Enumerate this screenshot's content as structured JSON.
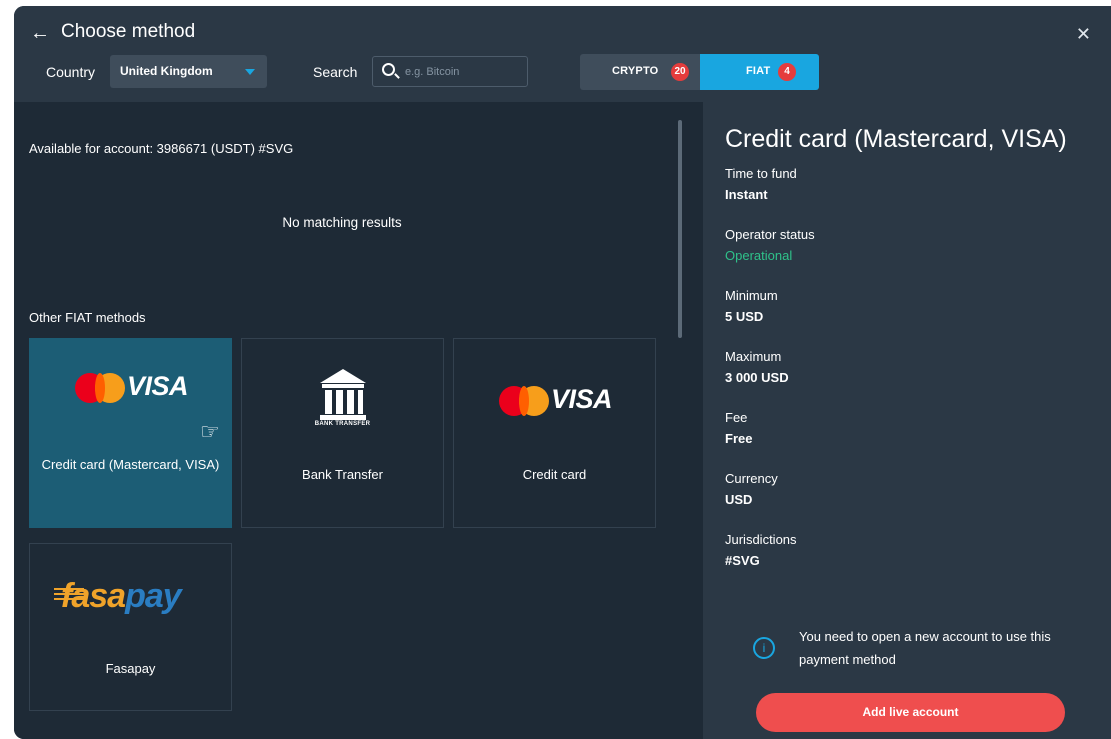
{
  "header": {
    "title": "Choose method",
    "country_label": "Country",
    "country_value": "United Kingdom",
    "search_label": "Search",
    "search_placeholder": "e.g. Bitcoin",
    "tabs": [
      {
        "label": "CRYPTO",
        "count": "20",
        "active": false
      },
      {
        "label": "FIAT",
        "count": "4",
        "active": true
      }
    ]
  },
  "left": {
    "available_text": "Available for account: 3986671 (USDT) #SVG",
    "no_results": "No matching results",
    "other_title": "Other FIAT methods",
    "methods": [
      {
        "label": "Credit card (Mastercard, VISA)",
        "logo": "mastercard-visa",
        "selected": true
      },
      {
        "label": "Bank Transfer",
        "logo": "bank-transfer",
        "logo_caption": "BANK TRANSFER",
        "selected": false
      },
      {
        "label": "Credit card",
        "logo": "mastercard-visa",
        "selected": false
      },
      {
        "label": "Fasapay",
        "logo": "fasapay",
        "selected": false
      }
    ],
    "visa_text": "VISA",
    "fasapay_logo": {
      "part1": "fasa",
      "part2": "pay"
    }
  },
  "detail": {
    "title": "Credit card (Mastercard, VISA)",
    "fields": [
      {
        "key": "Time to fund",
        "value": "Instant"
      },
      {
        "key": "Operator status",
        "value": "Operational"
      },
      {
        "key": "Minimum",
        "value": "5 USD"
      },
      {
        "key": "Maximum",
        "value": "3 000 USD"
      },
      {
        "key": "Fee",
        "value": "Free"
      },
      {
        "key": "Currency",
        "value": "USD"
      },
      {
        "key": "Jurisdictions",
        "value": "#SVG"
      }
    ],
    "notice": "You need to open a new account to use this payment method",
    "button": "Add live account"
  },
  "colors": {
    "accent": "#19a6e0",
    "status_green": "#2fc28a",
    "cta_red": "#ef4e4e",
    "selected_card": "#1c5d75"
  }
}
